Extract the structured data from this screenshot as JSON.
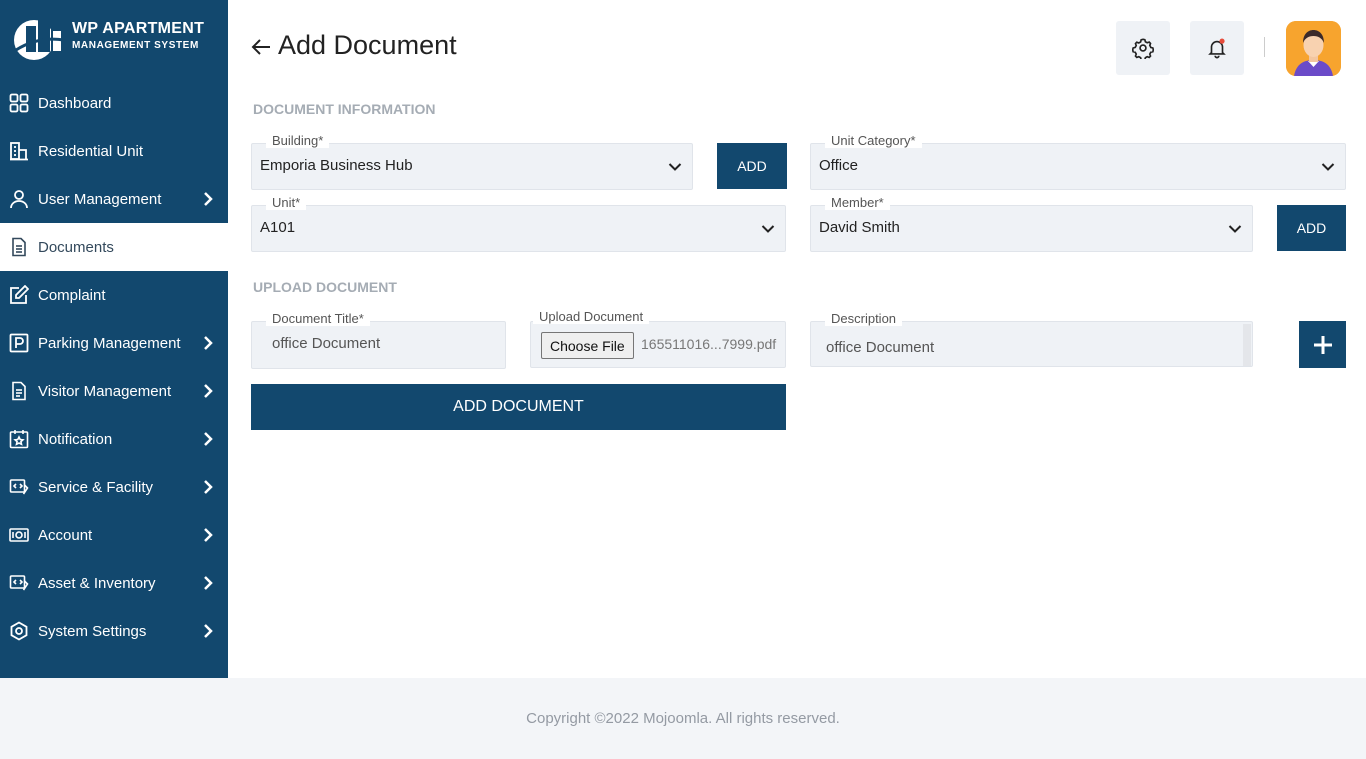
{
  "brand": {
    "line1": "WP APARTMENT",
    "line2": "MANAGEMENT SYSTEM"
  },
  "nav": [
    {
      "label": "Dashboard",
      "icon": "dashboard-icon",
      "chevron": false,
      "active": false
    },
    {
      "label": "Residential Unit",
      "icon": "building-icon",
      "chevron": false,
      "active": false
    },
    {
      "label": "User Management",
      "icon": "user-icon",
      "chevron": true,
      "active": false
    },
    {
      "label": "Documents",
      "icon": "document-icon",
      "chevron": false,
      "active": true
    },
    {
      "label": "Complaint",
      "icon": "edit-icon",
      "chevron": false,
      "active": false
    },
    {
      "label": "Parking Management",
      "icon": "parking-icon",
      "chevron": true,
      "active": false
    },
    {
      "label": "Visitor Management",
      "icon": "visitor-icon",
      "chevron": true,
      "active": false
    },
    {
      "label": "Notification",
      "icon": "calendar-star-icon",
      "chevron": true,
      "active": false
    },
    {
      "label": "Service & Facility",
      "icon": "service-icon",
      "chevron": true,
      "active": false
    },
    {
      "label": "Account",
      "icon": "money-icon",
      "chevron": true,
      "active": false
    },
    {
      "label": "Asset & Inventory",
      "icon": "asset-icon",
      "chevron": true,
      "active": false
    },
    {
      "label": "System Settings",
      "icon": "settings-eye-icon",
      "chevron": true,
      "active": false
    }
  ],
  "header": {
    "title": "Add Document"
  },
  "doc_info": {
    "heading": "DOCUMENT INFORMATION",
    "building": {
      "label": "Building*",
      "value": "Emporia Business Hub"
    },
    "unit_category": {
      "label": "Unit Category*",
      "value": "Office"
    },
    "unit": {
      "label": "Unit*",
      "value": "A101"
    },
    "member": {
      "label": "Member*",
      "value": "David Smith"
    },
    "add_label": "ADD"
  },
  "upload": {
    "heading": "UPLOAD DOCUMENT",
    "title_label": "Document Title*",
    "title_value": "office Document",
    "file_label": "Upload Document",
    "choose_label": "Choose File",
    "file_name": "165511016...7999.pdf",
    "desc_label": "Description",
    "desc_value": "office Document",
    "submit_label": "ADD DOCUMENT"
  },
  "footer": {
    "text": "Copyright ©2022 Mojoomla. All rights reserved."
  },
  "colors": {
    "primary": "#12486e",
    "field_bg": "#eff2f6",
    "notification_dot": "#e74c3c"
  }
}
